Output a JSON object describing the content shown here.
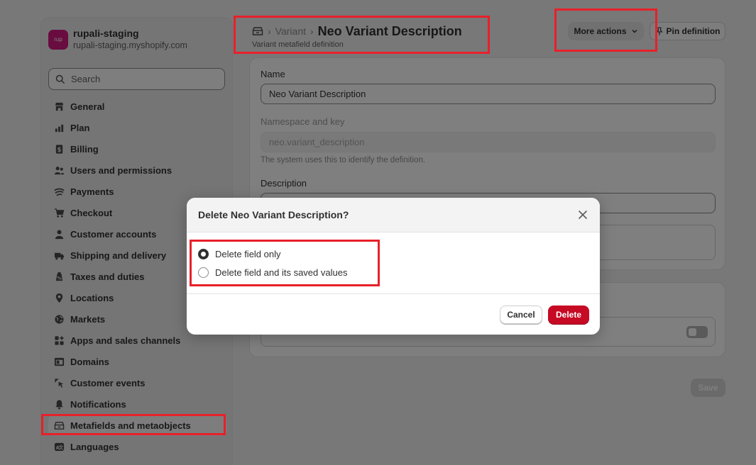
{
  "store": {
    "avatar_text": "rup",
    "name": "rupali-staging",
    "domain": "rupali-staging.myshopify.com",
    "avatar_color": "#d3187f"
  },
  "search": {
    "placeholder": "Search"
  },
  "sidebar": {
    "items": [
      {
        "label": "General",
        "icon": "store-icon"
      },
      {
        "label": "Plan",
        "icon": "plan-icon"
      },
      {
        "label": "Billing",
        "icon": "billing-icon"
      },
      {
        "label": "Users and permissions",
        "icon": "users-icon"
      },
      {
        "label": "Payments",
        "icon": "payments-icon"
      },
      {
        "label": "Checkout",
        "icon": "cart-icon"
      },
      {
        "label": "Customer accounts",
        "icon": "person-icon"
      },
      {
        "label": "Shipping and delivery",
        "icon": "truck-icon"
      },
      {
        "label": "Taxes and duties",
        "icon": "tax-icon"
      },
      {
        "label": "Locations",
        "icon": "location-icon"
      },
      {
        "label": "Markets",
        "icon": "globe-icon"
      },
      {
        "label": "Apps and sales channels",
        "icon": "apps-icon"
      },
      {
        "label": "Domains",
        "icon": "domains-icon"
      },
      {
        "label": "Customer events",
        "icon": "cursor-icon"
      },
      {
        "label": "Notifications",
        "icon": "bell-icon"
      },
      {
        "label": "Metafields and metaobjects",
        "icon": "metafields-icon",
        "active": true
      },
      {
        "label": "Languages",
        "icon": "language-icon"
      }
    ]
  },
  "header": {
    "breadcrumb_parent": "Variant",
    "title": "Neo Variant Description",
    "subtitle": "Variant metafield definition",
    "more_actions": "More actions",
    "pin": "Pin definition"
  },
  "form": {
    "name_label": "Name",
    "name_value": "Neo Variant Description",
    "namespace_label": "Namespace and key",
    "namespace_value": "neo.variant_description",
    "namespace_help": "The system uses this to identify the definition.",
    "description_label": "Description",
    "save": "Save"
  },
  "modal": {
    "title": "Delete Neo Variant Description?",
    "options": [
      {
        "label": "Delete field only",
        "checked": true
      },
      {
        "label": "Delete field and its saved values",
        "checked": false
      }
    ],
    "cancel": "Cancel",
    "delete": "Delete"
  },
  "colors": {
    "highlight": "#e8202a",
    "delete": "#c70a24"
  }
}
